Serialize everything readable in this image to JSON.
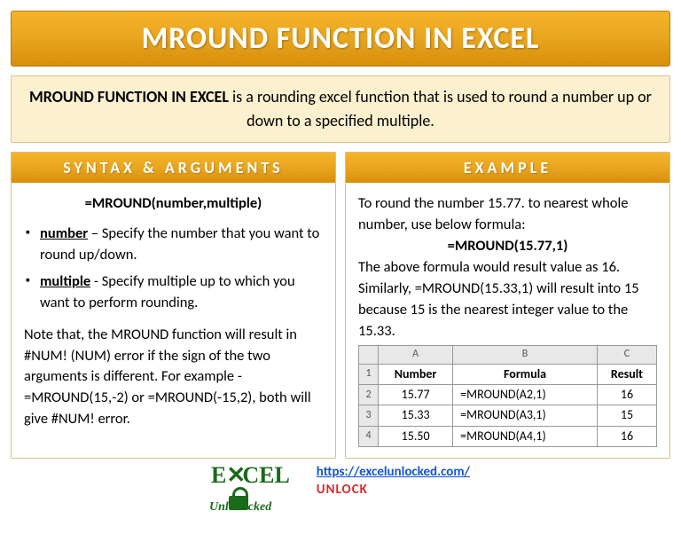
{
  "title": "MROUND FUNCTION IN EXCEL",
  "intro": {
    "bold": "MROUND FUNCTION IN EXCEL",
    "rest": " is a rounding excel function that is used to round a number up or down to a specified multiple."
  },
  "syntax": {
    "header": "SYNTAX & ARGUMENTS",
    "formula": "=MROUND(number,multiple)",
    "args": [
      {
        "name": "number",
        "desc": " – Specify the number that you want to round up/down."
      },
      {
        "name": "multiple",
        "desc": " - Specify multiple up to which you want to perform rounding."
      }
    ],
    "note": "Note that, the MROUND function will result in #NUM! (NUM) error if the sign of the two arguments is different. For example - =MROUND(15,-2) or =MROUND(-15,2), both will give #NUM! error."
  },
  "example": {
    "header": "EXAMPLE",
    "p1": "To round the number 15.77. to nearest whole number, use below formula:",
    "formula": "=MROUND(15.77,1)",
    "p2": "The above formula would result value as 16.",
    "p3": "Similarly, =MROUND(15.33,1) will result into 15 because 15 is the nearest integer value to the 15.33.",
    "table": {
      "cols": [
        "A",
        "B",
        "C"
      ],
      "header_row": [
        "Number",
        "Formula",
        "Result"
      ],
      "rows": [
        {
          "n": "2",
          "a": "15.77",
          "b": "=MROUND(A2,1)",
          "c": "16"
        },
        {
          "n": "3",
          "a": "15.33",
          "b": "=MROUND(A3,1)",
          "c": "15"
        },
        {
          "n": "4",
          "a": "15.50",
          "b": "=MROUND(A4,1)",
          "c": "16"
        }
      ]
    }
  },
  "footer": {
    "logo_main": "E CEL",
    "logo_sub": "Unl   cked",
    "url": "https://excelunlocked.com/",
    "tag": "UNLOCK"
  }
}
